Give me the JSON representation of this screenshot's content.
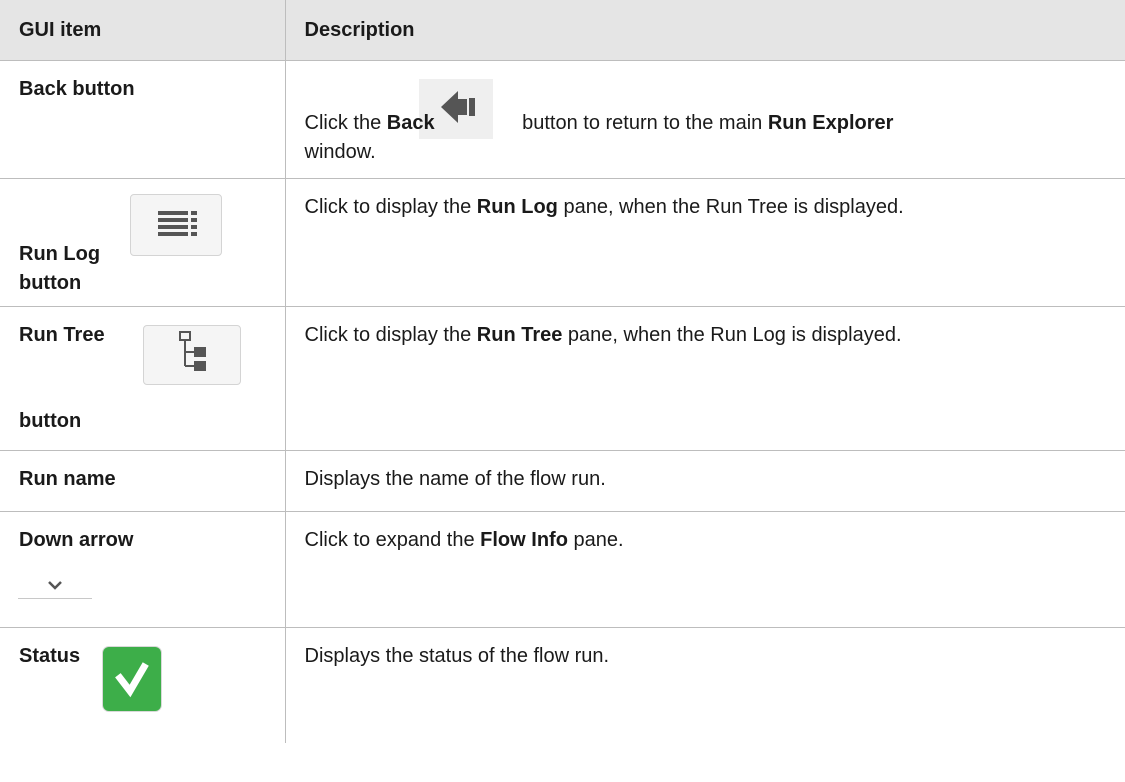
{
  "header": {
    "col_item": "GUI item",
    "col_description": "Description"
  },
  "rows": [
    {
      "item": "Back button",
      "icon": "back-arrow-icon",
      "desc_prefix": "Click the ",
      "desc_bold1": "Back",
      "desc_middle": " button to return to the main ",
      "desc_bold2": "Run Explorer",
      "desc_suffix": "window."
    },
    {
      "item_line1": "Run Log",
      "item_line2": "button",
      "icon": "run-log-icon",
      "desc_prefix": "Click to display the ",
      "desc_bold": "Run Log",
      "desc_suffix": " pane, when the Run Tree is displayed."
    },
    {
      "item_line1": "Run Tree",
      "item_line2": "button",
      "icon": "run-tree-icon",
      "desc_prefix": "Click to display the ",
      "desc_bold": "Run Tree",
      "desc_suffix": " pane, when the Run Log is displayed."
    },
    {
      "item": "Run name",
      "desc": "Displays the name of the flow run."
    },
    {
      "item": "Down arrow",
      "icon": "chevron-down-icon",
      "desc_prefix": "Click to expand the ",
      "desc_bold": "Flow Info",
      "desc_suffix": " pane."
    },
    {
      "item": "Status",
      "icon": "status-check-icon",
      "desc": "Displays the status of the flow run."
    }
  ],
  "colors": {
    "header_bg": "#e5e5e5",
    "border": "#bdbdbd",
    "status_green": "#3dae49"
  }
}
